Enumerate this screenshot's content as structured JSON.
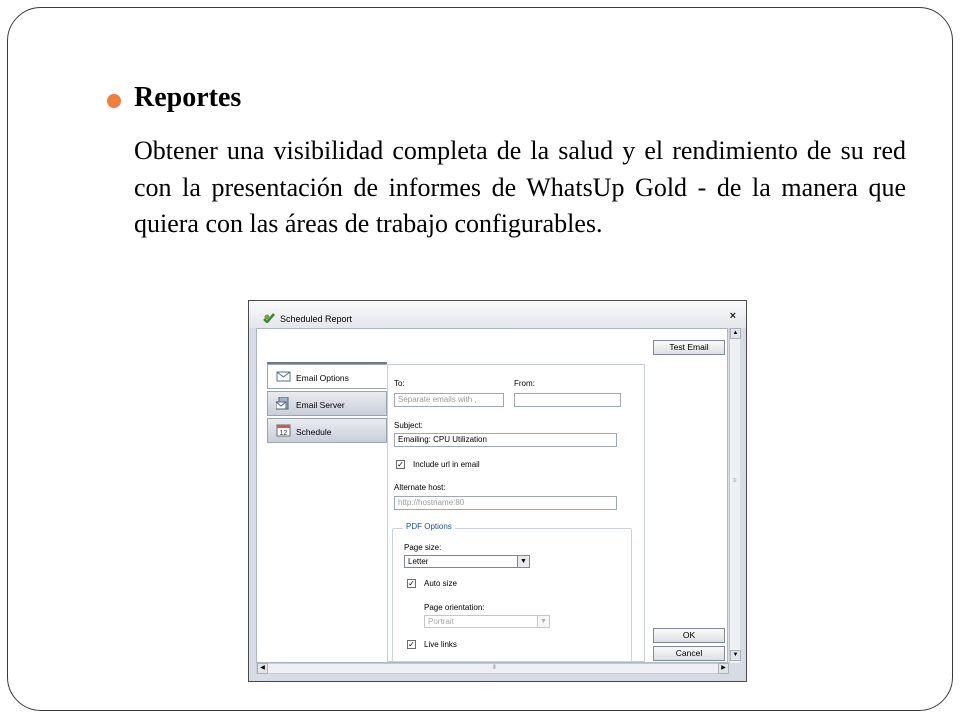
{
  "slide": {
    "heading": "Reportes",
    "body": "Obtener una visibilidad completa de la salud y el rendimiento de su red con la presentación de informes de WhatsUp Gold - de la manera que quiera con las áreas de trabajo configurables.",
    "bullet_color": "#f07f3c"
  },
  "dialog": {
    "title": "Scheduled Report",
    "close_glyph": "×",
    "tabs": [
      {
        "label": "Email Options",
        "icon": "envelope-icon",
        "active": true
      },
      {
        "label": "Email Server",
        "icon": "email-server-icon",
        "active": false
      },
      {
        "label": "Schedule",
        "icon": "calendar-icon",
        "active": false,
        "icon_text": "12"
      }
    ],
    "form": {
      "to_label": "To:",
      "to_placeholder": "Separate emails with ,",
      "from_label": "From:",
      "from_value": "",
      "subject_label": "Subject:",
      "subject_value": "Emailing: CPU Utilization",
      "include_url_label": "Include url in email",
      "include_url_checked": true,
      "alt_host_label": "Alternate host:",
      "alt_host_placeholder": "http://hostname:80",
      "pdf_options": {
        "legend": "PDF Options",
        "page_size_label": "Page size:",
        "page_size_value": "Letter",
        "auto_size_label": "Auto size",
        "auto_size_checked": true,
        "orientation_label": "Page orientation:",
        "orientation_value": "Portrait",
        "live_links_label": "Live links",
        "live_links_checked": true
      }
    },
    "buttons": {
      "test_email": "Test Email",
      "ok": "OK",
      "cancel": "Cancel"
    },
    "check_glyph": "✓"
  }
}
